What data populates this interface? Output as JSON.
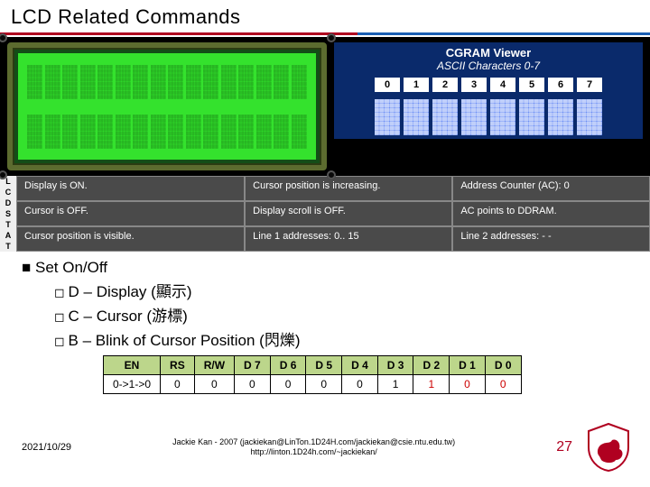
{
  "title": "LCD Related Commands",
  "cgram": {
    "title": "CGRAM Viewer",
    "subtitle": "ASCII Characters 0-7",
    "headers": [
      "0",
      "1",
      "2",
      "3",
      "4",
      "5",
      "6",
      "7"
    ]
  },
  "status": {
    "side_label": [
      "L",
      "C",
      "D",
      "S",
      "T",
      "A",
      "T"
    ],
    "cells": [
      [
        "Display is ON.",
        "Cursor position is increasing.",
        "Address Counter (AC): 0"
      ],
      [
        "Cursor is OFF.",
        "Display scroll is OFF.",
        "AC points to DDRAM."
      ],
      [
        "Cursor position is visible.",
        "Line 1 addresses: 0.. 15",
        "Line 2 addresses: - -"
      ]
    ]
  },
  "bullet": {
    "main": "Set On/Off",
    "subs": [
      "D – Display (顯示)",
      "C – Cursor (游標)",
      "B – Blink of Cursor Position (閃爍)"
    ]
  },
  "table": {
    "headers": [
      "EN",
      "RS",
      "R/W",
      "D 7",
      "D 6",
      "D 5",
      "D 4",
      "D 3",
      "D 2",
      "D 1",
      "D 0"
    ],
    "row": [
      "0->1->0",
      "0",
      "0",
      "0",
      "0",
      "0",
      "0",
      "1",
      "1",
      "0",
      "0"
    ],
    "red_cols": [
      8,
      9,
      10
    ]
  },
  "footer": {
    "date": "2021/10/29",
    "credit_line1": "Jackie Kan - 2007 (jackiekan@LinTon.1D24H.com/jackiekan@csie.ntu.edu.tw)",
    "credit_line2": "http://linton.1D24h.com/~jackiekan/",
    "page": "27"
  }
}
